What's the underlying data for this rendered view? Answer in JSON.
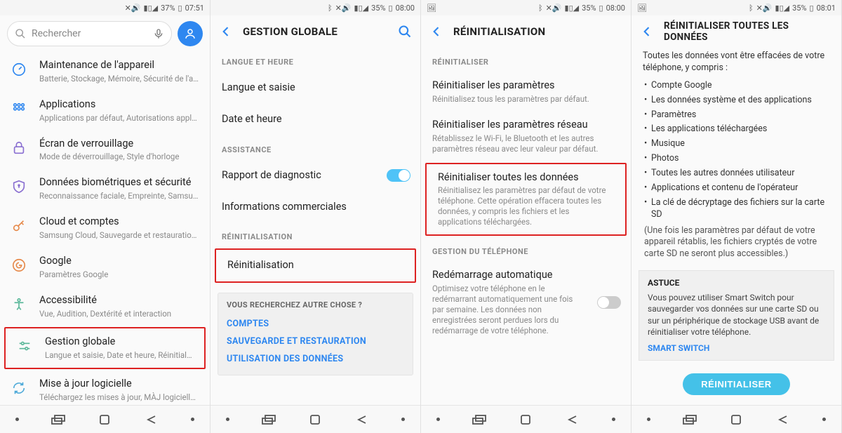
{
  "screens": [
    {
      "statusbar": {
        "has_pic_icon": false,
        "bt": false,
        "mute": true,
        "signal": true,
        "battery": "37%",
        "time": "07:51"
      },
      "search": {
        "placeholder": "Rechercher"
      },
      "items": [
        {
          "icon": "gauge",
          "title": "Maintenance de l'appareil",
          "subtitle": "Batterie, Stockage, Mémoire, Sécurité de l'a…"
        },
        {
          "icon": "grid",
          "title": "Applications",
          "subtitle": "Applications par défaut, Autorisations appli…"
        },
        {
          "icon": "lock",
          "title": "Écran de verrouillage",
          "subtitle": "Mode de déverrouillage, Style d'horloge"
        },
        {
          "icon": "shield",
          "title": "Données biométriques et sécurité",
          "subtitle": "Reconnaissance faciale, Empreinte, Samsun…"
        },
        {
          "icon": "key",
          "title": "Cloud et comptes",
          "subtitle": "Samsung Cloud, Sauvegarde et restauration…"
        },
        {
          "icon": "google",
          "title": "Google",
          "subtitle": "Paramètres Google"
        },
        {
          "icon": "access",
          "title": "Accessibilité",
          "subtitle": "Vue, Audition, Dextérité et interaction"
        },
        {
          "icon": "sliders",
          "title": "Gestion globale",
          "subtitle": "Langue et saisie, Date et heure, Réinitialisati…",
          "highlight": true
        },
        {
          "icon": "update",
          "title": "Mise à jour logicielle",
          "subtitle": "Téléchargez les mises à jour, MÀJ logicielle…"
        }
      ]
    },
    {
      "statusbar": {
        "has_pic_icon": false,
        "bt": true,
        "mute": true,
        "signal": true,
        "battery": "35%",
        "time": "08:00"
      },
      "appbar": {
        "title": "GESTION GLOBALE",
        "search": true
      },
      "sections": [
        {
          "header": "LANGUE ET HEURE",
          "items": [
            {
              "title": "Langue et saisie"
            },
            {
              "title": "Date et heure"
            }
          ]
        },
        {
          "header": "ASSISTANCE",
          "items": [
            {
              "title": "Rapport de diagnostic",
              "toggle": "on"
            },
            {
              "title": "Informations commerciales"
            }
          ]
        },
        {
          "header": "RÉINITIALISATION",
          "items": [
            {
              "title": "Réinitialisation",
              "highlight": true
            }
          ]
        }
      ],
      "suggestions": {
        "header": "VOUS RECHERCHEZ AUTRE CHOSE ?",
        "links": [
          "COMPTES",
          "SAUVEGARDE ET RESTAURATION",
          "UTILISATION DES DONNÉES"
        ]
      }
    },
    {
      "statusbar": {
        "has_pic_icon": true,
        "bt": true,
        "mute": true,
        "signal": true,
        "battery": "35%",
        "time": "08:00"
      },
      "appbar": {
        "title": "RÉINITIALISATION",
        "search": false
      },
      "sections": [
        {
          "header": "RÉINITIALISER",
          "items": [
            {
              "title": "Réinitialiser les paramètres",
              "subtitle": "Réinitialisez tous les paramètres par défaut."
            },
            {
              "title": "Réinitialiser les paramètres réseau",
              "subtitle": "Rétablissez le Wi-Fi, le Bluetooth et les autres paramètres réseau avec leur valeur par défaut."
            },
            {
              "title": "Réinitialiser toutes les données",
              "subtitle": "Réinitialisez les paramètres par défaut de votre téléphone. Cette opération effacera toutes les données, y compris les fichiers et les applications téléchargées.",
              "highlight": true
            }
          ]
        },
        {
          "header": "GESTION DU TÉLÉPHONE",
          "items": [
            {
              "title": "Redémarrage automatique",
              "subtitle": "Optimisez votre téléphone en le redémarrant automatiquement une fois par semaine. Les données non enregistrées seront perdues lors du redémarrage de votre téléphone.",
              "toggle": "off"
            }
          ]
        }
      ]
    },
    {
      "statusbar": {
        "has_pic_icon": true,
        "bt": true,
        "mute": true,
        "signal": true,
        "battery": "35%",
        "time": "08:01"
      },
      "appbar": {
        "title": "RÉINITIALISER TOUTES LES DONNÉES",
        "search": false
      },
      "intro": "Toutes les données vont être effacées de votre téléphone, y compris :",
      "bullets": [
        "Compte Google",
        "Les données système et des applications",
        "Paramètres",
        "Les applications téléchargées",
        "Musique",
        "Photos",
        "Toutes les autres données utilisateur",
        "Applications et contenu de l'opérateur",
        "La clé de décryptage des fichiers sur la carte SD"
      ],
      "note": "(Une fois les paramètres par défaut de votre appareil rétablis, les fichiers cryptés de votre carte SD ne seront plus accessibles.)",
      "tip": {
        "header": "ASTUCE",
        "text": "Vous pouvez utiliser Smart Switch pour sauvegarder vos données sur une carte SD ou sur un périphérique de stockage USB avant de réinitialiser votre téléphone.",
        "link": "SMART SWITCH"
      },
      "button": "RÉINITIALISER"
    }
  ]
}
